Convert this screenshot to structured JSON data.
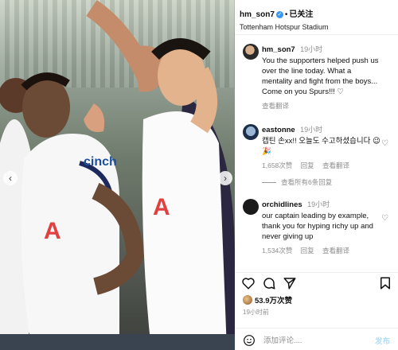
{
  "post": {
    "author": "hm_son7",
    "follow_label": "已关注",
    "location": "Tottenham Hotspur Stadium",
    "caption_author": "hm_son7",
    "caption_time": "19小时",
    "caption_text": "You the supporters helped push us over the line today. What a mentality and fight from the boys... Come on you Spurs!!! ♡",
    "caption_translate": "查看翻译"
  },
  "comments": [
    {
      "user": "eastonne",
      "time": "19小时",
      "text": "캡틴 손xx!! 오늘도 수고하셨습니다 😉 🎉",
      "likes": "1,658次赞",
      "reply": "回复",
      "translate": "查看翻译"
    },
    {
      "user": "orchidlines",
      "time": "19小时",
      "text": "our captain leading by example, thank you for hyping richy up and never giving up",
      "likes": "1,534次赞",
      "reply": "回复",
      "translate": "查看翻译"
    }
  ],
  "view_replies": "查看所有6条回复",
  "likes_total": "53.9万次赞",
  "post_age": "19小时前",
  "add_comment": {
    "placeholder": "添加评论....",
    "send": "发布"
  },
  "colors": {
    "verified": "#3897f0",
    "muted": "#8e8e8e",
    "media_bg": "#5a5f58"
  },
  "icons": [
    "verified-badge-icon",
    "heart-icon",
    "comment-icon",
    "share-icon",
    "bookmark-icon",
    "smile-icon",
    "chevron-left-icon",
    "chevron-right-icon"
  ]
}
